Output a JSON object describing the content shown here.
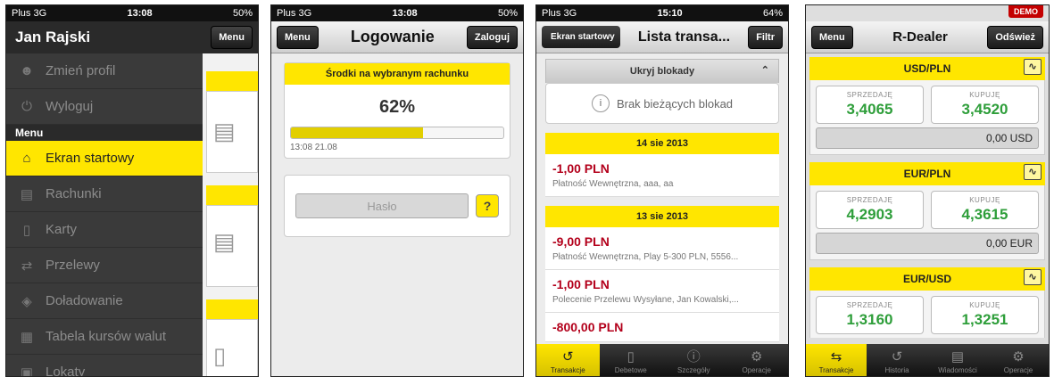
{
  "screen1": {
    "status": {
      "carrier": "Plus",
      "network": "3G",
      "time": "13:08",
      "battery": "50%"
    },
    "user_name": "Jan Rajski",
    "menu_button": "Menu",
    "profile_items": [
      {
        "label": "Zmień profil",
        "icon": "users-icon"
      },
      {
        "label": "Wyloguj",
        "icon": "power-icon"
      }
    ],
    "section_label": "Menu",
    "menu_items": [
      {
        "label": "Ekran startowy",
        "icon": "home-icon",
        "active": true
      },
      {
        "label": "Rachunki",
        "icon": "document-icon"
      },
      {
        "label": "Karty",
        "icon": "card-icon"
      },
      {
        "label": "Przelewy",
        "icon": "transfer-icon"
      },
      {
        "label": "Doładowanie",
        "icon": "topup-icon"
      },
      {
        "label": "Tabela kursów walut",
        "icon": "table-icon"
      },
      {
        "label": "Lokaty",
        "icon": "deposit-icon"
      }
    ]
  },
  "screen2": {
    "status": {
      "carrier": "Plus",
      "network": "3G",
      "time": "13:08",
      "battery": "50%"
    },
    "menu_button": "Menu",
    "title": "Logowanie",
    "login_button": "Zaloguj",
    "funds_header": "Środki na wybranym rachunku",
    "percent_label": "62%",
    "percent_value": 0.62,
    "timestamp": "13:08 21.08",
    "password_placeholder": "Hasło",
    "help_label": "?"
  },
  "screen3": {
    "status": {
      "carrier": "Plus",
      "network": "3G",
      "time": "15:10",
      "battery": "64%"
    },
    "back_button": "Ekran startowy",
    "title": "Lista transa...",
    "filter_button": "Filtr",
    "blocks_header": "Ukryj blokady",
    "no_blocks": "Brak bieżących blokad",
    "groups": [
      {
        "date": "14 sie 2013",
        "items": [
          {
            "amount": "-1,00 PLN",
            "desc": "Płatność Wewnętrzna, aaa, aa"
          }
        ]
      },
      {
        "date": "13 sie 2013",
        "items": [
          {
            "amount": "-9,00 PLN",
            "desc": "Płatność Wewnętrzna, Play 5-300 PLN, 5556..."
          },
          {
            "amount": "-1,00 PLN",
            "desc": "Polecenie Przelewu Wysyłane, Jan Kowalski,..."
          },
          {
            "amount": "-800,00 PLN",
            "desc": ""
          }
        ]
      }
    ],
    "tabs": [
      {
        "label": "Transakcje",
        "icon": "history-icon",
        "active": true
      },
      {
        "label": "Debetowe",
        "icon": "card-icon"
      },
      {
        "label": "Szczegóły",
        "icon": "info-icon"
      },
      {
        "label": "Operacje",
        "icon": "gear-icon"
      }
    ]
  },
  "screen4": {
    "demo_badge": "DEMO",
    "menu_button": "Menu",
    "title": "R-Dealer",
    "refresh_button": "Odśwież",
    "sell_label": "SPRZEDAJĘ",
    "buy_label": "KUPUJĘ",
    "pairs": [
      {
        "pair": "USD/PLN",
        "sell": "3,4065",
        "buy": "3,4520",
        "amount": "0,00 USD"
      },
      {
        "pair": "EUR/PLN",
        "sell": "4,2903",
        "buy": "4,3615",
        "amount": "0,00 EUR"
      },
      {
        "pair": "EUR/USD",
        "sell": "1,3160",
        "buy": "1,3251",
        "amount": ""
      }
    ],
    "tabs": [
      {
        "label": "Transakcje",
        "icon": "exchange-icon",
        "active": true
      },
      {
        "label": "Historia",
        "icon": "history-icon"
      },
      {
        "label": "Wiadomości",
        "icon": "message-icon"
      },
      {
        "label": "Operacje",
        "icon": "gear-icon"
      }
    ]
  }
}
